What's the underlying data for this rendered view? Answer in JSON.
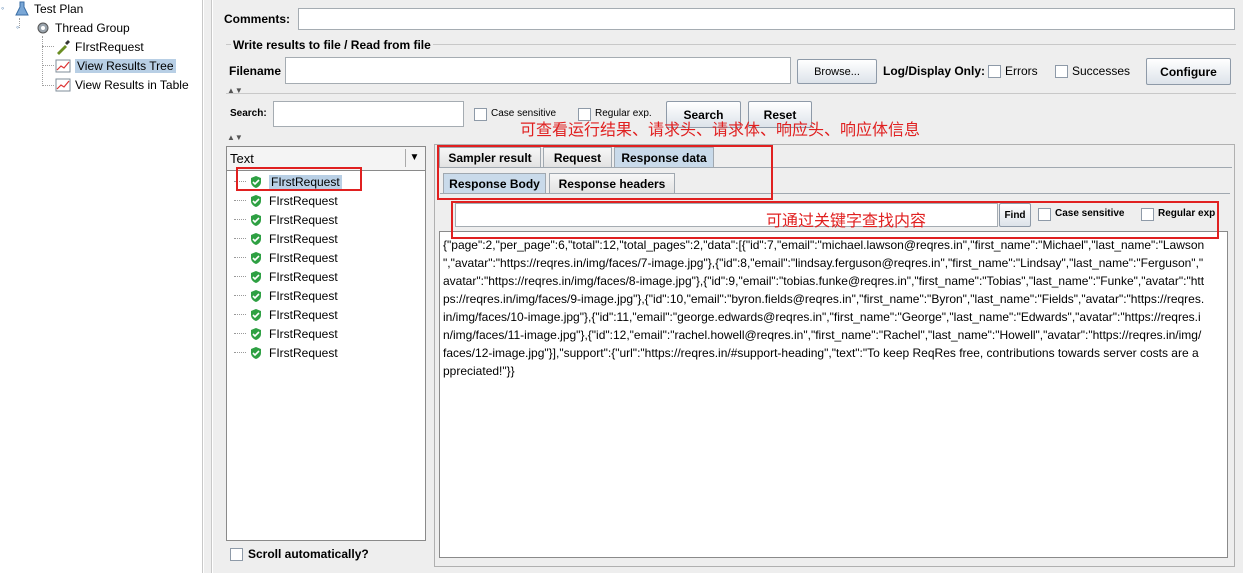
{
  "tree": {
    "items": [
      {
        "label": "Test Plan",
        "icon": "test-plan-icon"
      },
      {
        "label": "Thread Group",
        "icon": "gear-icon"
      },
      {
        "label": "FIrstRequest",
        "icon": "pipette-icon"
      },
      {
        "label": "View Results Tree",
        "icon": "graph-icon"
      },
      {
        "label": "View Results in Table",
        "icon": "graph-icon"
      }
    ]
  },
  "form": {
    "comments_label": "Comments:",
    "comments_value": "",
    "write_results_title": "Write results to file / Read from file",
    "filename_label": "Filename",
    "filename_value": "",
    "browse_label": "Browse...",
    "log_display_label": "Log/Display Only:",
    "errors_label": "Errors",
    "successes_label": "Successes",
    "configure_label": "Configure"
  },
  "search": {
    "label": "Search:",
    "value": "",
    "case_sensitive_label": "Case sensitive",
    "regex_label": "Regular exp.",
    "search_button": "Search",
    "reset_button": "Reset"
  },
  "results": {
    "header": "Text",
    "items": [
      "FIrstRequest",
      "FIrstRequest",
      "FIrstRequest",
      "FIrstRequest",
      "FIrstRequest",
      "FIrstRequest",
      "FIrstRequest",
      "FIrstRequest",
      "FIrstRequest",
      "FIrstRequest"
    ],
    "scroll_auto_label": "Scroll automatically?"
  },
  "tabs": {
    "main": [
      "Sampler result",
      "Request",
      "Response data"
    ],
    "sub": [
      "Response Body",
      "Response headers"
    ]
  },
  "find": {
    "value": "",
    "button": "Find",
    "case_sensitive_label": "Case sensitive",
    "regex_label": "Regular exp"
  },
  "response_lines": [
    "{\"page\":2,\"per_page\":6,\"total\":12,\"total_pages\":2,\"data\":[{\"id\":7,\"email\":\"michael.lawson@reqres.in\",\"first_name\":\"Michael\",\"last_name\":\"Lawson",
    "\",\"avatar\":\"https://reqres.in/img/faces/7-image.jpg\"},{\"id\":8,\"email\":\"lindsay.ferguson@reqres.in\",\"first_name\":\"Lindsay\",\"last_name\":\"Ferguson\",\"",
    "avatar\":\"https://reqres.in/img/faces/8-image.jpg\"},{\"id\":9,\"email\":\"tobias.funke@reqres.in\",\"first_name\":\"Tobias\",\"last_name\":\"Funke\",\"avatar\":\"htt",
    "ps://reqres.in/img/faces/9-image.jpg\"},{\"id\":10,\"email\":\"byron.fields@reqres.in\",\"first_name\":\"Byron\",\"last_name\":\"Fields\",\"avatar\":\"https://reqres.",
    "in/img/faces/10-image.jpg\"},{\"id\":11,\"email\":\"george.edwards@reqres.in\",\"first_name\":\"George\",\"last_name\":\"Edwards\",\"avatar\":\"https://reqres.i",
    "n/img/faces/11-image.jpg\"},{\"id\":12,\"email\":\"rachel.howell@reqres.in\",\"first_name\":\"Rachel\",\"last_name\":\"Howell\",\"avatar\":\"https://reqres.in/img/",
    "faces/12-image.jpg\"}],\"support\":{\"url\":\"https://reqres.in/#support-heading\",\"text\":\"To keep ReqRes free, contributions towards server costs are a",
    "ppreciated!\"}}"
  ],
  "annotations": {
    "tabs_note": "可查看运行结果、请求头、请求体、响应头、响应体信息",
    "find_note": "可通过关键字查找内容"
  },
  "colors": {
    "annotation": "#e02020",
    "selection": "#b8cfe5",
    "success": "#2ea043"
  }
}
